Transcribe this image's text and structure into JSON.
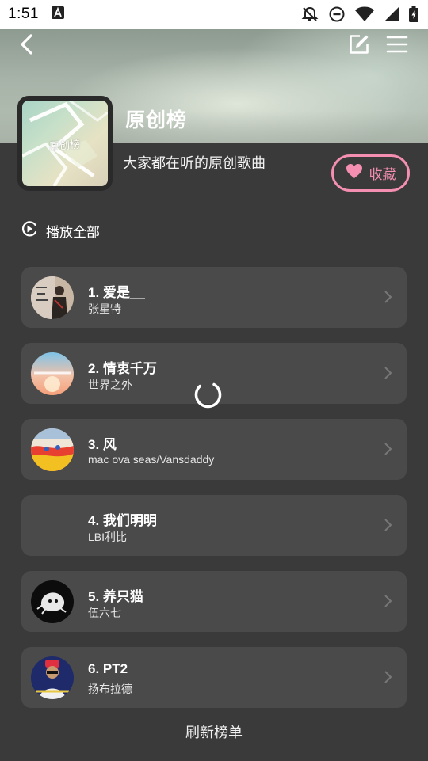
{
  "status_bar": {
    "time": "1:51",
    "icons": [
      "a-notification-icon",
      "dnd-off-icon",
      "do-not-disturb-icon",
      "wifi-icon",
      "signal-icon",
      "battery-icon"
    ]
  },
  "nav": {
    "icons": [
      "back-icon",
      "edit-icon",
      "menu-icon"
    ]
  },
  "playlist": {
    "title": "原创榜",
    "cover_text": "原创榜",
    "description": "大家都在听的原创歌曲",
    "favorite_label": "收藏",
    "play_all_label": "播放全部"
  },
  "songs": [
    {
      "title": "1. 爱是__",
      "artist": "张星特"
    },
    {
      "title": "2. 情衷千万",
      "artist": "世界之外"
    },
    {
      "title": "3. 风",
      "artist": "mac ova seas/Vansdaddy"
    },
    {
      "title": "4. 我们明明",
      "artist": "LBI利比"
    },
    {
      "title": "5. 养只猫",
      "artist": "伍六七"
    },
    {
      "title": "6. PT2",
      "artist": "扬布拉德"
    }
  ],
  "refresh_label": "刷新榜单",
  "colors": {
    "background": "#3a3a3a",
    "card": "#4a4a4a",
    "accent_pink": "#f48fb1"
  }
}
